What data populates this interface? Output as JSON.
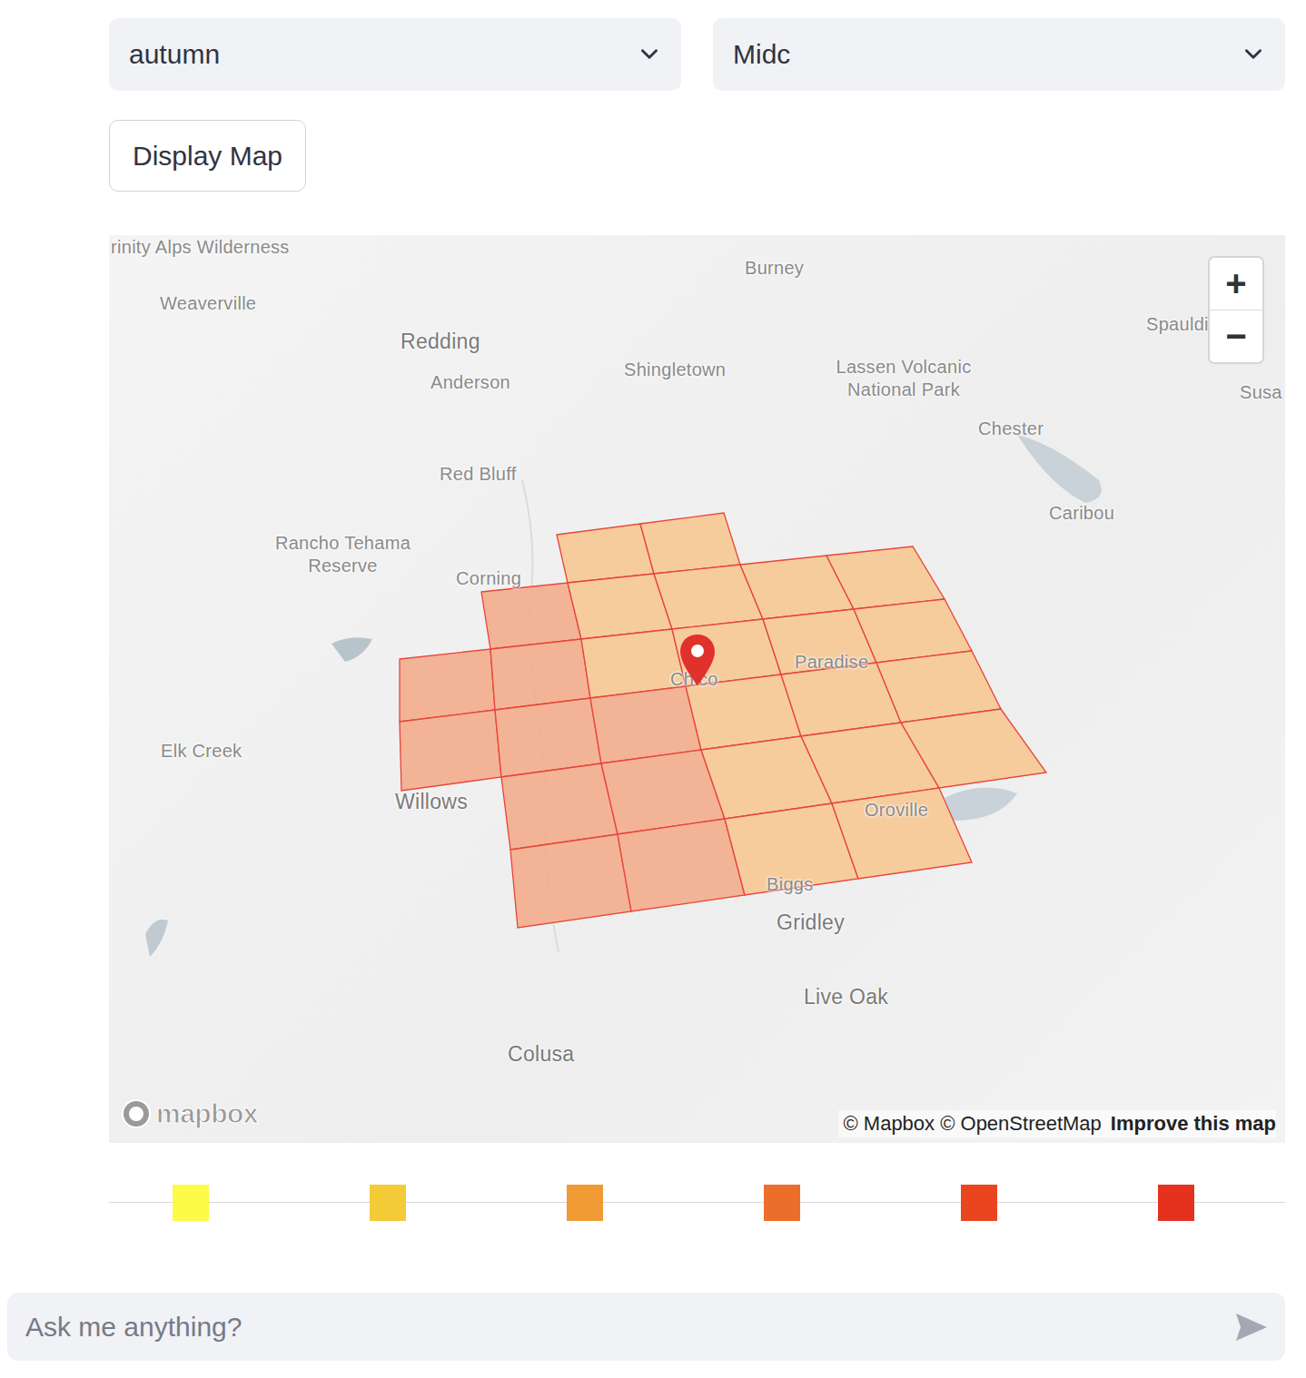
{
  "filters": [
    {
      "value": "autumn"
    },
    {
      "value": "Midc"
    }
  ],
  "button": "Display Map",
  "map": {
    "labels": [
      "rinity Alps Wilderness",
      "Weaverville",
      "Redding",
      "Anderson",
      "Burney",
      "Shingletown",
      "Lassen Volcanic National Park",
      "Spauldi",
      "Susa",
      "Chester",
      "Caribou",
      "Red Bluff",
      "Rancho Tehama Reserve",
      "Corning",
      "Chico",
      "Paradise",
      "Elk Creek",
      "Willows",
      "Oroville",
      "Biggs",
      "Gridley",
      "Live Oak",
      "Colusa"
    ],
    "grid": [
      [
        null,
        null,
        {
          "color": "#f6c893"
        },
        {
          "color": "#f6c893"
        },
        null,
        null
      ],
      [
        null,
        {
          "color": "#f3ac8c"
        },
        {
          "color": "#f6c893"
        },
        {
          "color": "#f6c893"
        },
        {
          "color": "#f6c893"
        },
        {
          "color": "#f6c893"
        }
      ],
      [
        {
          "color": "#f3ac8c"
        },
        {
          "color": "#f3ac8c"
        },
        {
          "color": "#f6c893"
        },
        {
          "color": "#f6c893"
        },
        {
          "color": "#f6c893"
        },
        {
          "color": "#f6c893"
        }
      ],
      [
        {
          "color": "#f3ac8c"
        },
        {
          "color": "#f3ac8c"
        },
        {
          "color": "#f3ac8c"
        },
        {
          "color": "#f6c893"
        },
        {
          "color": "#f6c893"
        },
        {
          "color": "#f6c893"
        }
      ],
      [
        null,
        {
          "color": "#f3ac8c"
        },
        {
          "color": "#f3ac8c"
        },
        {
          "color": "#f6c893"
        },
        {
          "color": "#f6c893"
        },
        {
          "color": "#f6c893"
        }
      ],
      [
        null,
        {
          "color": "#f3ac8c"
        },
        {
          "color": "#f3ac8c"
        },
        {
          "color": "#f6c893"
        },
        {
          "color": "#f6c893"
        },
        null
      ]
    ],
    "zoom_in": "+",
    "zoom_out": "−",
    "logo": "mapbox",
    "attribution": "© Mapbox © OpenStreetMap",
    "improve": "Improve this map"
  },
  "legend": [
    {
      "color": "#fdfb47"
    },
    {
      "color": "#f2cb36"
    },
    {
      "color": "#ef9a33"
    },
    {
      "color": "#ec6e2a"
    },
    {
      "color": "#e9461f"
    },
    {
      "color": "#e5321e"
    }
  ],
  "chat": {
    "placeholder": "Ask me anything?"
  }
}
